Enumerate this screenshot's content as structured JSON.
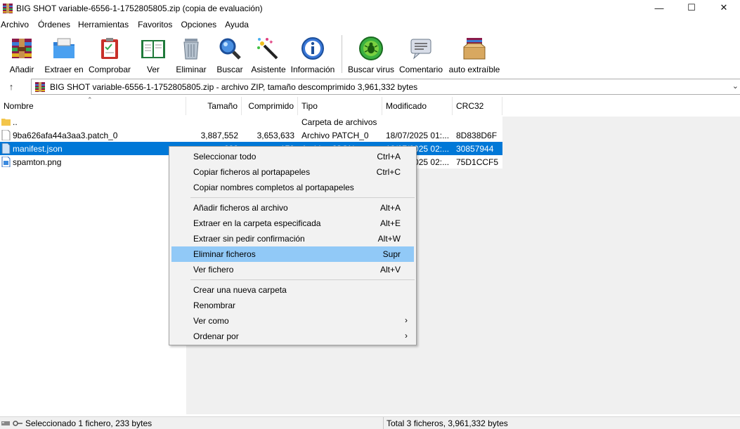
{
  "window": {
    "title": "BIG SHOT variable-6556-1-1752805805.zip (copia de evaluación)",
    "minimize": "—",
    "maximize": "☐",
    "close": "✕"
  },
  "menu": [
    "Archivo",
    "Órdenes",
    "Herramientas",
    "Favoritos",
    "Opciones",
    "Ayuda"
  ],
  "toolbar": [
    {
      "label": "Añadir",
      "icon": "add-archive-icon"
    },
    {
      "label": "Extraer en",
      "icon": "extract-folder-icon"
    },
    {
      "label": "Comprobar",
      "icon": "test-clipboard-icon"
    },
    {
      "label": "Ver",
      "icon": "view-book-icon"
    },
    {
      "label": "Eliminar",
      "icon": "trash-bin-icon"
    },
    {
      "label": "Buscar",
      "icon": "magnifier-icon"
    },
    {
      "label": "Asistente",
      "icon": "magic-wand-icon"
    },
    {
      "label": "Información",
      "icon": "info-icon"
    },
    {
      "label": "Buscar virus",
      "icon": "virus-scan-icon"
    },
    {
      "label": "Comentario",
      "icon": "comment-icon"
    },
    {
      "label": "auto extraíble",
      "icon": "sfx-box-icon"
    }
  ],
  "address": {
    "path": "BIG SHOT variable-6556-1-1752805805.zip - archivo ZIP, tamaño descomprimido 3,961,332 bytes",
    "up": "↑",
    "chevron": "⌄"
  },
  "columns": [
    "Nombre",
    "Tamaño",
    "Comprimido",
    "Tipo",
    "Modificado",
    "CRC32"
  ],
  "sort_indicator": "⌃",
  "files": [
    {
      "name": "..",
      "size": "",
      "packed": "",
      "type": "Carpeta de archivos",
      "modified": "",
      "crc": "",
      "icon": "folder-icon"
    },
    {
      "name": "9ba626afa44a3aa3.patch_0",
      "size": "3,887,552",
      "packed": "3,653,633",
      "type": "Archivo PATCH_0",
      "modified": "18/07/2025 01:...",
      "crc": "8D838D6F",
      "icon": "file-icon"
    },
    {
      "name": "manifest.json",
      "size": "233",
      "packed": "179",
      "type": "Archivo JSON",
      "modified": "18/07/2025 02:...",
      "crc": "30857944",
      "icon": "json-file-icon"
    },
    {
      "name": "spamton.png",
      "size": "",
      "packed": "",
      "type": "",
      "modified": "18/07/2025 02:...",
      "crc": "75D1CCF5",
      "icon": "image-file-icon"
    }
  ],
  "context_menu": [
    {
      "label": "Seleccionar todo",
      "shortcut": "Ctrl+A"
    },
    {
      "label": "Copiar ficheros al portapapeles",
      "shortcut": "Ctrl+C"
    },
    {
      "label": "Copiar nombres completos al portapapeles",
      "shortcut": ""
    },
    {
      "label": "Añadir ficheros al archivo",
      "shortcut": "Alt+A"
    },
    {
      "label": "Extraer en la carpeta especificada",
      "shortcut": "Alt+E"
    },
    {
      "label": "Extraer sin pedir confirmación",
      "shortcut": "Alt+W"
    },
    {
      "label": "Eliminar ficheros",
      "shortcut": "Supr"
    },
    {
      "label": "Ver fichero",
      "shortcut": "Alt+V"
    },
    {
      "label": "Crear una nueva carpeta",
      "shortcut": ""
    },
    {
      "label": "Renombrar",
      "shortcut": ""
    },
    {
      "label": "Ver como",
      "shortcut": "",
      "submenu": "›"
    },
    {
      "label": "Ordenar por",
      "shortcut": "",
      "submenu": "›"
    }
  ],
  "status": {
    "selected": "Seleccionado 1 fichero, 233 bytes",
    "total": "Total 3 ficheros, 3,961,332 bytes"
  },
  "colors": {
    "selection": "#0078d7",
    "menu_highlight": "#91c9f7"
  }
}
